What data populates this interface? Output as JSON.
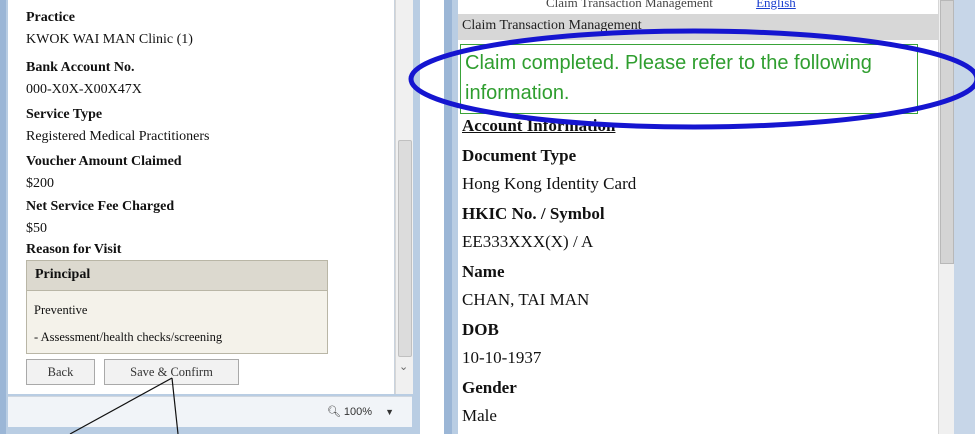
{
  "left": {
    "fields": [
      {
        "label": "Practice",
        "value": "KWOK WAI MAN Clinic (1)"
      },
      {
        "label": "Bank Account No.",
        "value": "000-X0X-X00X47X"
      },
      {
        "label": "Service Type",
        "value": "Registered Medical Practitioners"
      },
      {
        "label": "Voucher Amount Claimed",
        "value": "$200"
      },
      {
        "label": "Net Service Fee Charged",
        "value": "$50"
      }
    ],
    "reason_label": "Reason for Visit",
    "reason_box": {
      "header": "Principal",
      "line1": "Preventive",
      "line2": "- Assessment/health checks/screening"
    },
    "buttons": {
      "back": "Back",
      "save_confirm": "Save & Confirm"
    },
    "zoom": "100%"
  },
  "right": {
    "top_cut_text": "Claim Transaction Management",
    "top_cut_link": "English",
    "section_title": "Claim Transaction Management",
    "message": "Claim completed. Please refer to the following information.",
    "account_info_title": "Account Information",
    "fields": [
      {
        "label": "Document Type",
        "value": "Hong Kong Identity Card"
      },
      {
        "label": "HKIC No. / Symbol",
        "value": "EE333XXX(X) / A"
      },
      {
        "label": "Name",
        "value": "CHAN, TAI MAN"
      },
      {
        "label": "DOB",
        "value": "10-10-1937"
      },
      {
        "label": "Gender",
        "value": "Male"
      }
    ]
  },
  "colors": {
    "success_green": "#2f9e2f",
    "annotation_blue": "#1515d0",
    "window_frame": "#b9cde3"
  },
  "icons": [
    "magnifier-zoom-icon",
    "chevron-down-icon",
    "scroll-down-arrow-icon"
  ]
}
